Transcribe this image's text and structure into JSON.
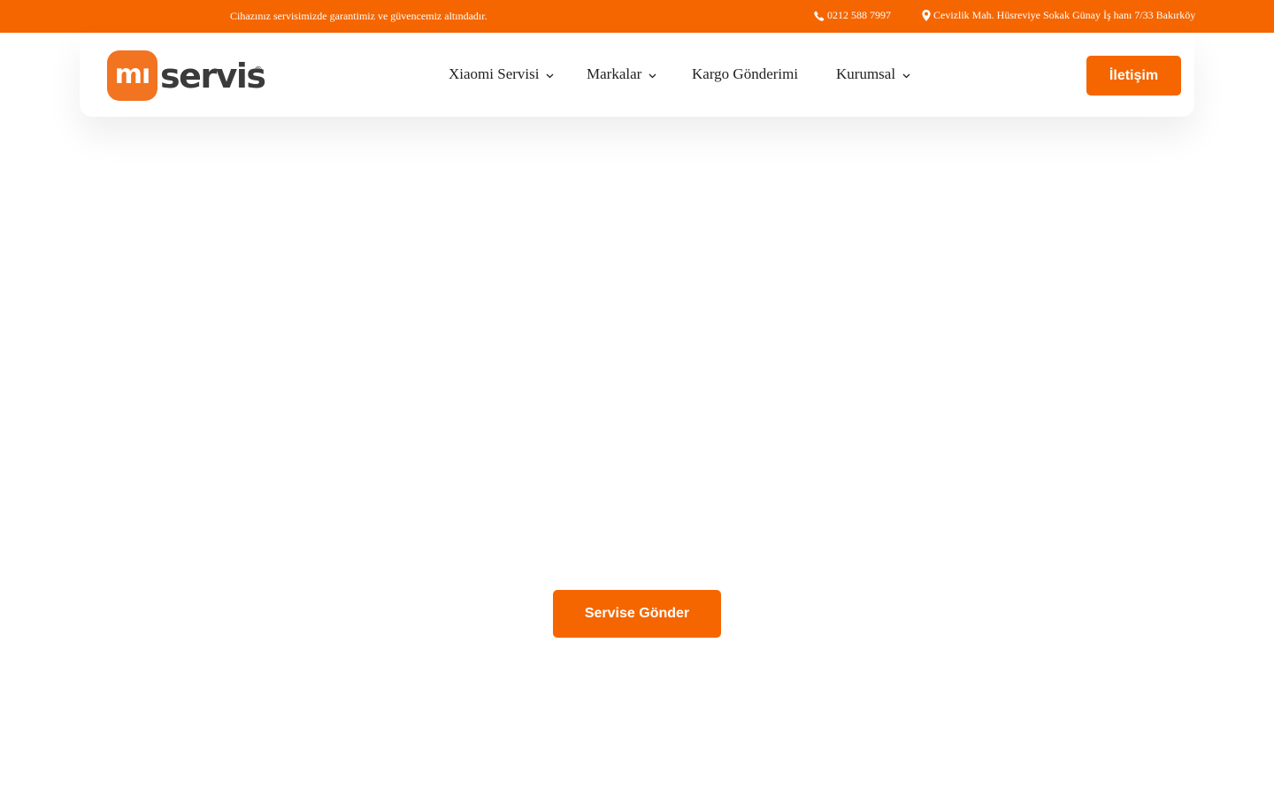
{
  "topbar": {
    "tagline": "Cihazınız servisimizde garantimiz ve güvencemiz altındadır.",
    "phone": "0212 588 7997",
    "address": "Cevizlik Mah. Hüsreviye Sokak Günay İş hanı 7/33 Bakırköy",
    "phone_icon": "phone-icon",
    "address_icon": "map-marker-icon"
  },
  "logo": {
    "badge_text": "mı",
    "word": "servis",
    "registered": "®"
  },
  "nav": {
    "items": [
      {
        "label": "Xiaomi Servisi",
        "has_dropdown": true
      },
      {
        "label": "Markalar",
        "has_dropdown": true
      },
      {
        "label": "Kargo Gönderimi",
        "has_dropdown": false
      },
      {
        "label": "Kurumsal",
        "has_dropdown": true
      }
    ]
  },
  "header": {
    "contact_button": "İletişim"
  },
  "hero": {
    "service_button": "Servise Gönder"
  },
  "colors": {
    "accent": "#f56600",
    "logo_badge": "#f27320",
    "text_dark": "#222222"
  }
}
